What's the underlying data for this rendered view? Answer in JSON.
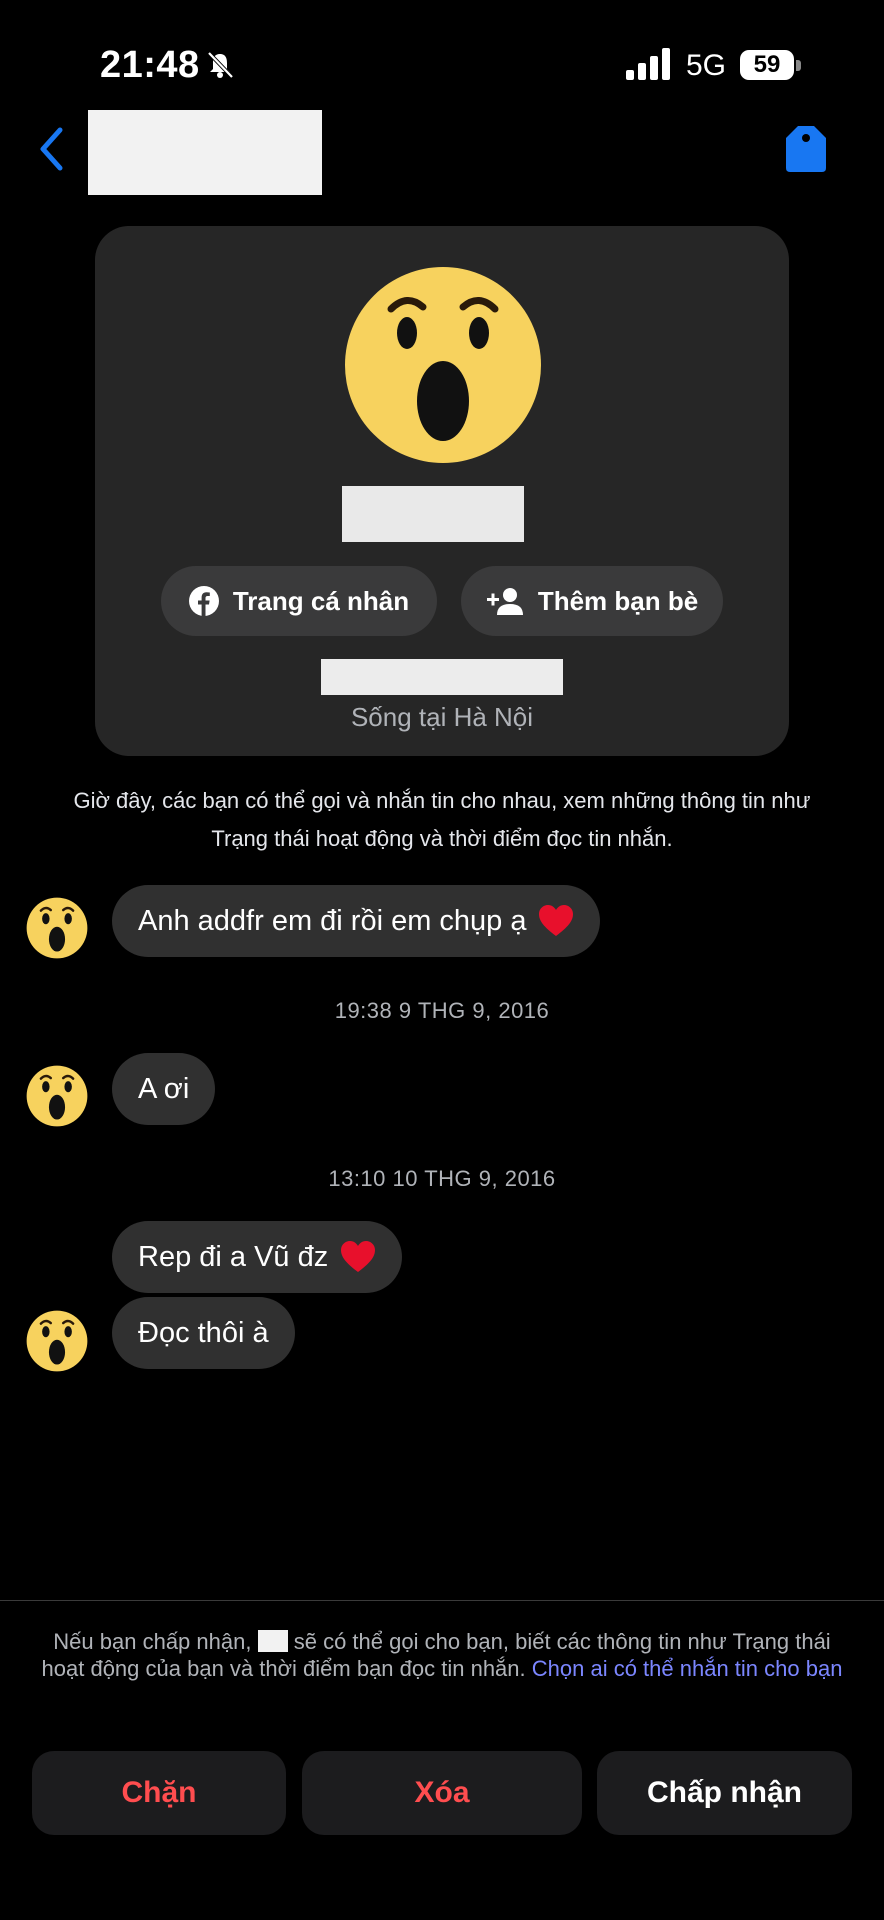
{
  "status_bar": {
    "time": "21:48",
    "network": "5G",
    "battery": "59"
  },
  "profile": {
    "facebook_button": "Trang cá nhân",
    "add_friend_button": "Thêm bạn bè",
    "location": "Sống tại Hà Nội"
  },
  "info_text_line1": "Giờ đây, các bạn có thể gọi và nhắn tin cho nhau, xem những thông tin như",
  "info_text_line2": "Trạng thái hoạt động và thời điểm đọc tin nhắn.",
  "messages": [
    {
      "text": "Anh addfr em đi rồi em chụp ạ"
    },
    {
      "timestamp": "19:38 9 THG 9, 2016"
    },
    {
      "text": "A ơi"
    },
    {
      "timestamp": "13:10 10 THG 9, 2016"
    },
    {
      "text": "Rep đi a Vũ đz"
    },
    {
      "text": "Đọc thôi à"
    }
  ],
  "notice": {
    "before": "Nếu bạn chấp nhận,",
    "after": "sẽ có thể gọi cho bạn, biết các thông tin như Trạng thái hoạt động của bạn và thời điểm bạn đọc tin nhắn.",
    "link": "Chọn ai có thể nhắn tin cho bạn"
  },
  "actions": {
    "block": "Chặn",
    "delete": "Xóa",
    "accept": "Chấp nhận"
  },
  "colors": {
    "accent_blue": "#1877f2",
    "danger_red": "#ff4d4f",
    "link": "#7b86ff",
    "bubble": "#303030"
  }
}
